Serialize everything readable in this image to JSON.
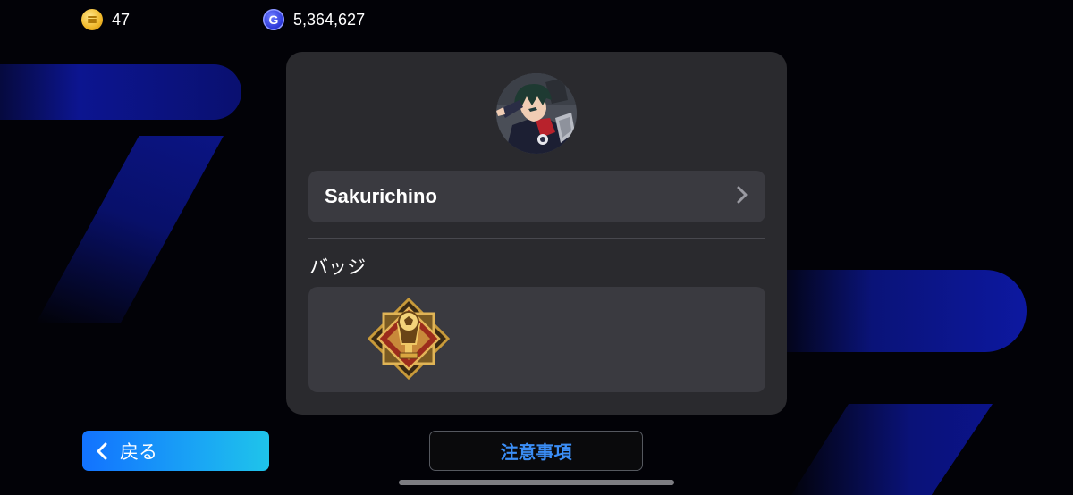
{
  "currency": {
    "coins": {
      "icon": "coin-icon",
      "value": "47"
    },
    "gems": {
      "icon": "g-currency-icon",
      "letter": "G",
      "value": "5,364,627"
    }
  },
  "profile": {
    "avatar": "avatar",
    "name": "Sakurichino",
    "badge_section_label": "バッジ",
    "badge": "trophy-badge-icon"
  },
  "buttons": {
    "back_label": "戻る",
    "notes_label": "注意事項"
  },
  "colors": {
    "accent_blue": "#1a8cff",
    "panel_bg": "#2a2a2e",
    "notes_text": "#3b8ef6"
  }
}
